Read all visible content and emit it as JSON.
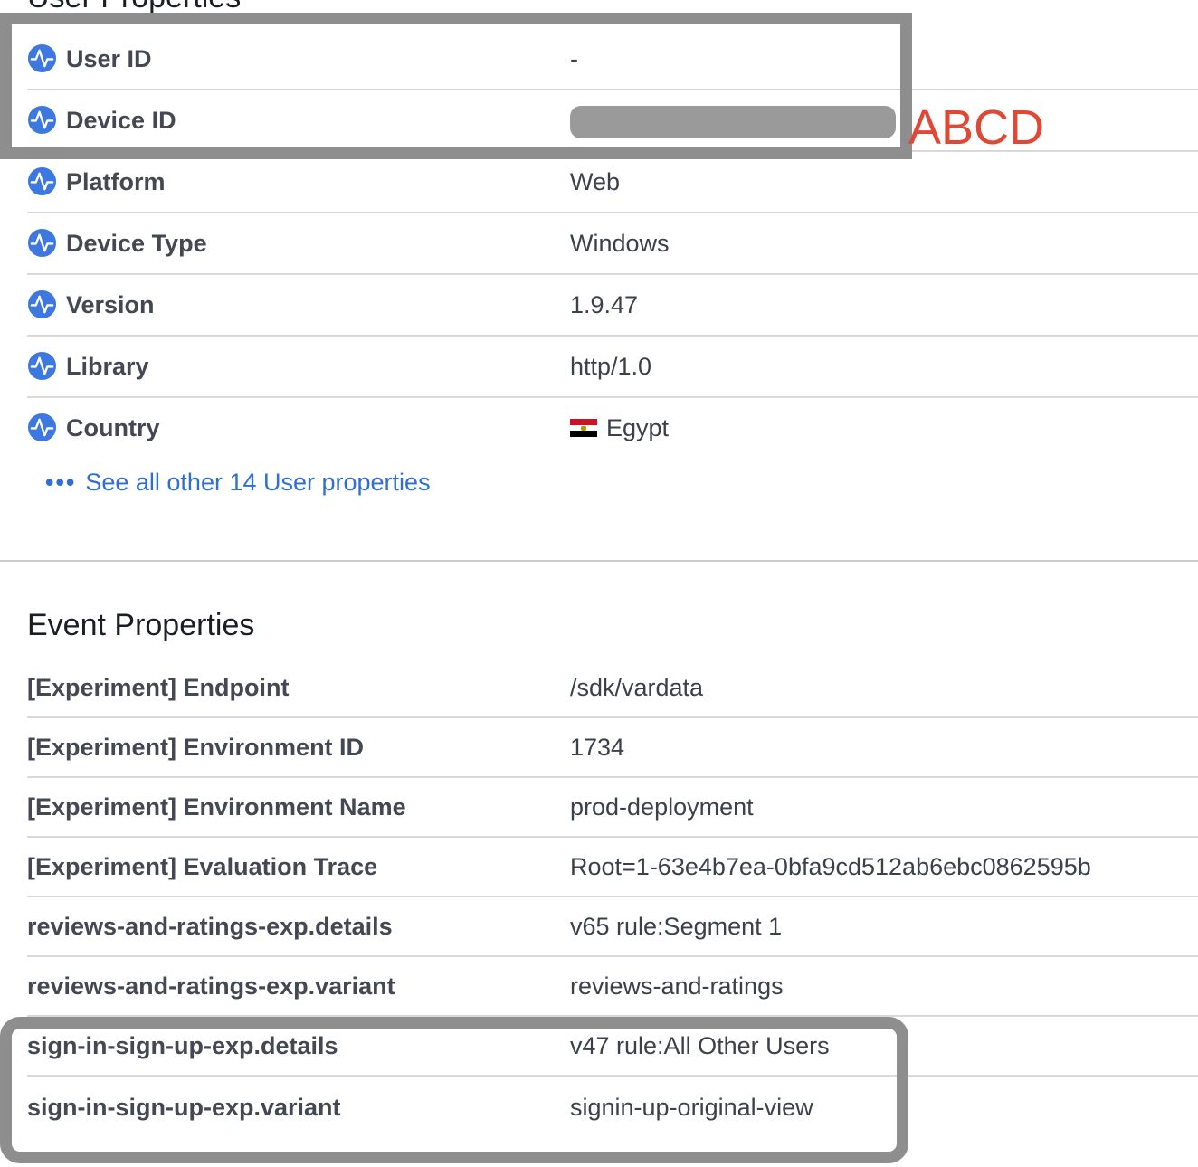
{
  "user_properties": {
    "title": "User Properties",
    "rows": [
      {
        "key": "User ID",
        "value": "-"
      },
      {
        "key": "Device ID",
        "value": ""
      },
      {
        "key": "Platform",
        "value": "Web"
      },
      {
        "key": "Device Type",
        "value": "Windows"
      },
      {
        "key": "Version",
        "value": "1.9.47"
      },
      {
        "key": "Library",
        "value": "http/1.0"
      },
      {
        "key": "Country",
        "value": "Egypt"
      }
    ],
    "see_all": "See all other 14 User properties"
  },
  "event_properties": {
    "title": "Event Properties",
    "rows": [
      {
        "key": "[Experiment] Endpoint",
        "value": "/sdk/vardata"
      },
      {
        "key": "[Experiment] Environment ID",
        "value": "1734"
      },
      {
        "key": "[Experiment] Environment Name",
        "value": "prod-deployment"
      },
      {
        "key": "[Experiment] Evaluation Trace",
        "value": "Root=1-63e4b7ea-0bfa9cd512ab6ebc0862595b"
      },
      {
        "key": "reviews-and-ratings-exp.details",
        "value": "v65 rule:Segment 1"
      },
      {
        "key": "reviews-and-ratings-exp.variant",
        "value": "reviews-and-ratings"
      },
      {
        "key": "sign-in-sign-up-exp.details",
        "value": "v47 rule:All Other Users"
      },
      {
        "key": "sign-in-sign-up-exp.variant",
        "value": "signin-up-original-view"
      }
    ]
  },
  "annotation": {
    "label": "ABCD"
  },
  "icons": {
    "property_icon": "amplitude-wave-icon",
    "more_icon": "ellipsis-icon",
    "flag_icon": "egypt-flag-icon"
  },
  "colors": {
    "link": "#2f6fd4",
    "icon": "#3d78e0",
    "annotation_text": "#e04836",
    "annotation_box": "#8e8e8e"
  }
}
